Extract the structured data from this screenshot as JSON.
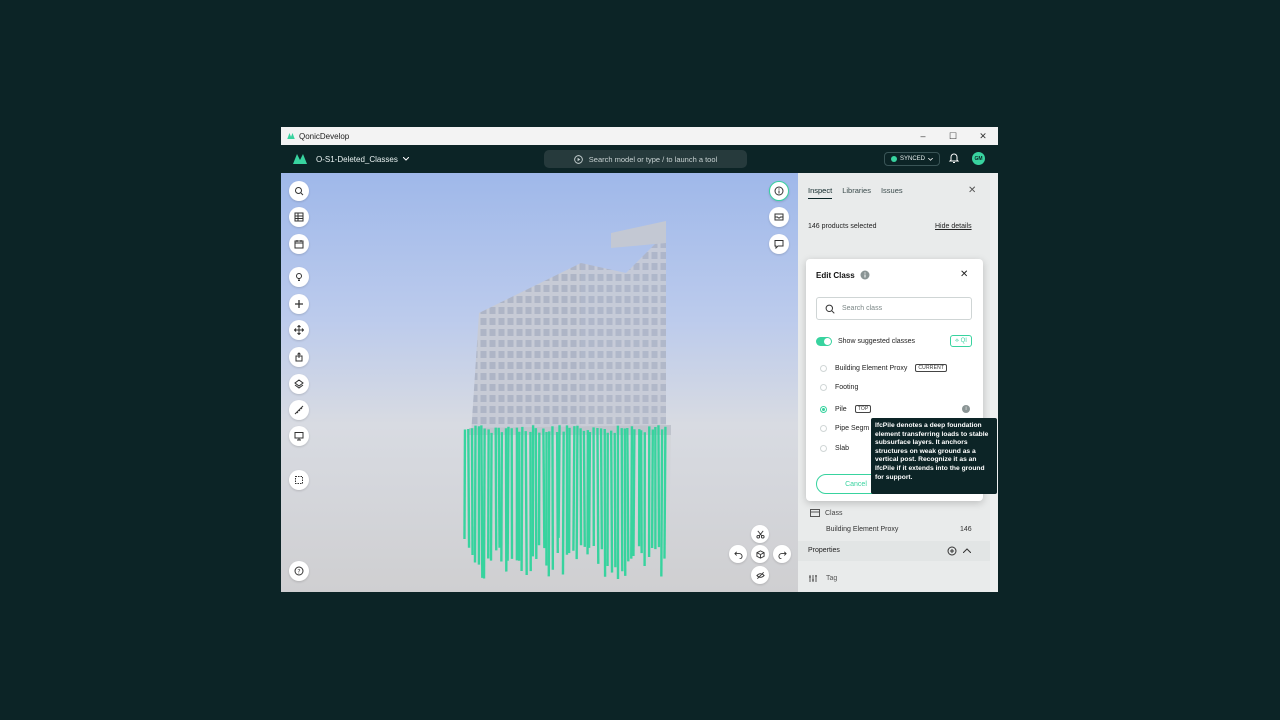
{
  "window": {
    "title": "QonicDevelop",
    "controls": [
      "–",
      "☐",
      "✕"
    ]
  },
  "appbar": {
    "project_name": "O-S1-Deleted_Classes",
    "search_placeholder": "Search model or type / to launch a tool",
    "sync_status": "SYNCED",
    "avatar_initials": "GM"
  },
  "left_toolbar": [
    "search-icon",
    "table-icon",
    "calendar-icon",
    "lightbulb-icon",
    "plus-icon",
    "move-icon",
    "export-icon",
    "layers-icon",
    "measure-icon",
    "presentation-icon",
    "select-box-icon",
    "help-icon"
  ],
  "right_toolbar": [
    "info-icon",
    "inbox-icon",
    "comment-icon"
  ],
  "panel": {
    "tabs": [
      "Inspect",
      "Libraries",
      "Issues"
    ],
    "selection_text": "146 products selected",
    "hide_details": "Hide details",
    "class_section_label": "Class",
    "class_value": "Building Element Proxy",
    "class_count": "146",
    "properties_label": "Properties",
    "tag_label": "Tag"
  },
  "dialog": {
    "title": "Edit Class",
    "search_placeholder": "Search class",
    "suggest_label": "Show suggested classes",
    "qi_label": "QI",
    "options": [
      {
        "label": "Building Element Proxy",
        "badge": "CURRENT",
        "selected": false
      },
      {
        "label": "Footing",
        "badge": "",
        "selected": false
      },
      {
        "label": "Pile",
        "badge": "TOP",
        "selected": true
      },
      {
        "label": "Pipe Segm",
        "badge": "",
        "selected": false
      },
      {
        "label": "Slab",
        "badge": "",
        "selected": false
      }
    ],
    "cancel_label": "Cancel"
  },
  "tooltip": {
    "text": "IfcPile denotes a deep foundation element transferring loads to stable subsurface layers. It anchors structures on weak ground as a vertical post. Recognize it as an IfcPile if it extends into the ground for support."
  },
  "colors": {
    "accent": "#38d39f",
    "dark": "#0c2426"
  }
}
